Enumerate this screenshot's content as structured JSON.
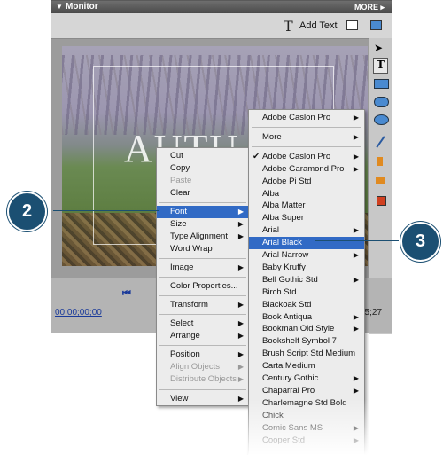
{
  "panel": {
    "title": "Monitor",
    "more": "MORE",
    "add_text": "Add Text"
  },
  "timecode": {
    "left": "00;00;00;00",
    "right": "15;27"
  },
  "video": {
    "title_text": "AUTU D"
  },
  "context_menu": {
    "items": [
      {
        "label": "Cut",
        "enabled": true
      },
      {
        "label": "Copy",
        "enabled": true
      },
      {
        "label": "Paste",
        "enabled": false
      },
      {
        "label": "Clear",
        "enabled": true
      },
      {
        "label": "Font",
        "enabled": true,
        "submenu": true,
        "highlighted": true
      },
      {
        "label": "Size",
        "enabled": true,
        "submenu": true
      },
      {
        "label": "Type Alignment",
        "enabled": true,
        "submenu": true
      },
      {
        "label": "Word Wrap",
        "enabled": true
      },
      {
        "label": "Image",
        "enabled": true,
        "submenu": true
      },
      {
        "label": "Color Properties...",
        "enabled": true
      },
      {
        "label": "Transform",
        "enabled": true,
        "submenu": true
      },
      {
        "label": "Select",
        "enabled": true,
        "submenu": true
      },
      {
        "label": "Arrange",
        "enabled": true,
        "submenu": true
      },
      {
        "label": "Position",
        "enabled": true,
        "submenu": true
      },
      {
        "label": "Align Objects",
        "enabled": false,
        "submenu": true
      },
      {
        "label": "Distribute Objects",
        "enabled": false,
        "submenu": true
      },
      {
        "label": "View",
        "enabled": true,
        "submenu": true
      }
    ]
  },
  "font_menu": {
    "items": [
      {
        "label": "Adobe Caslon Pro",
        "submenu": true
      },
      {
        "label": "More",
        "submenu": true
      },
      {
        "label": "Adobe Caslon Pro",
        "submenu": true,
        "checked": true
      },
      {
        "label": "Adobe Garamond Pro",
        "submenu": true
      },
      {
        "label": "Adobe Pi Std"
      },
      {
        "label": "Alba"
      },
      {
        "label": "Alba Matter"
      },
      {
        "label": "Alba Super"
      },
      {
        "label": "Arial",
        "submenu": true
      },
      {
        "label": "Arial Black",
        "highlighted": true
      },
      {
        "label": "Arial Narrow",
        "submenu": true
      },
      {
        "label": "Baby Kruffy"
      },
      {
        "label": "Bell Gothic Std",
        "submenu": true
      },
      {
        "label": "Birch Std"
      },
      {
        "label": "Blackoak Std"
      },
      {
        "label": "Book Antiqua",
        "submenu": true
      },
      {
        "label": "Bookman Old Style",
        "submenu": true
      },
      {
        "label": "Bookshelf Symbol 7"
      },
      {
        "label": "Brush Script Std Medium"
      },
      {
        "label": "Carta Medium"
      },
      {
        "label": "Century Gothic",
        "submenu": true
      },
      {
        "label": "Chaparral Pro",
        "submenu": true
      },
      {
        "label": "Charlemagne Std Bold"
      },
      {
        "label": "Chick"
      },
      {
        "label": "Comic Sans MS",
        "submenu": true
      },
      {
        "label": "Cooper Std",
        "submenu": true
      }
    ],
    "check_glyph": "✔"
  },
  "callouts": {
    "step_font": "2",
    "step_font_name": "3"
  },
  "colors": {
    "highlight": "#316ac5",
    "callout": "#1b4f72"
  }
}
